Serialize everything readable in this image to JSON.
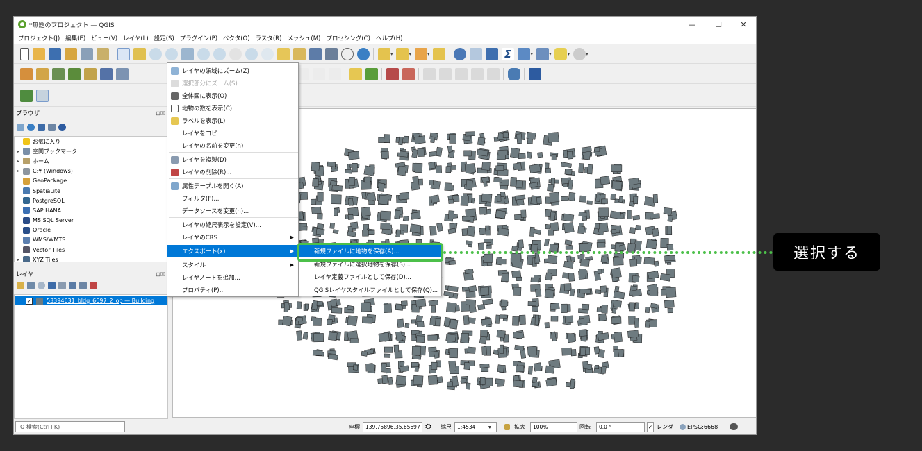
{
  "window": {
    "title": "*無題のプロジェクト — QGIS",
    "controls": [
      "—",
      "☐",
      "✕"
    ]
  },
  "menubar": [
    "プロジェクト(J)",
    "編集(E)",
    "ビュー(V)",
    "レイヤ(L)",
    "設定(S)",
    "プラグイン(P)",
    "ベクタ(O)",
    "ラスタ(R)",
    "メッシュ(M)",
    "プロセシング(C)",
    "ヘルプ(H)"
  ],
  "browser": {
    "title": "ブラウザ",
    "items": [
      {
        "label": "お気に入り",
        "icon": "star-icon",
        "arrow": ""
      },
      {
        "label": "空間ブックマーク",
        "icon": "bookmark-icon",
        "arrow": "▸"
      },
      {
        "label": "ホーム",
        "icon": "home-folder-icon",
        "arrow": "▸"
      },
      {
        "label": "C:¥ (Windows)",
        "icon": "drive-icon",
        "arrow": "▸"
      },
      {
        "label": "GeoPackage",
        "icon": "geopackage-icon",
        "arrow": ""
      },
      {
        "label": "SpatiaLite",
        "icon": "spatialite-icon",
        "arrow": ""
      },
      {
        "label": "PostgreSQL",
        "icon": "postgresql-icon",
        "arrow": ""
      },
      {
        "label": "SAP HANA",
        "icon": "sap-hana-icon",
        "arrow": ""
      },
      {
        "label": "MS SQL Server",
        "icon": "mssql-icon",
        "arrow": ""
      },
      {
        "label": "Oracle",
        "icon": "oracle-icon",
        "arrow": ""
      },
      {
        "label": "WMS/WMTS",
        "icon": "wms-icon",
        "arrow": ""
      },
      {
        "label": "Vector Tiles",
        "icon": "vector-tiles-icon",
        "arrow": ""
      },
      {
        "label": "XYZ Tiles",
        "icon": "xyz-tiles-icon",
        "arrow": "▸"
      }
    ]
  },
  "layers": {
    "title": "レイヤ",
    "layer_name": "53394631_bldg_6697_2_op — Building",
    "checked": "✓"
  },
  "context_menu": {
    "items": [
      {
        "label": "レイヤの領域にズーム(Z)",
        "icon": "zoom-layer-icon",
        "disabled": false,
        "submenu": false
      },
      {
        "label": "選択部分にズーム(S)",
        "icon": "zoom-selection-icon",
        "disabled": true,
        "submenu": false
      },
      {
        "label": "全体図に表示(O)",
        "icon": "overview-icon",
        "disabled": false,
        "submenu": false
      },
      {
        "label": "地物の数を表示(C)",
        "icon": "checkbox-icon",
        "disabled": false,
        "submenu": false
      },
      {
        "label": "ラベルを表示(L)",
        "icon": "label-icon",
        "disabled": false,
        "submenu": false
      },
      {
        "label": "レイヤをコピー",
        "icon": "",
        "disabled": false,
        "submenu": false
      },
      {
        "label": "レイヤの名前を変更(n)",
        "icon": "",
        "disabled": false,
        "submenu": false
      },
      {
        "label": "レイヤを複製(D)",
        "icon": "duplicate-icon",
        "disabled": false,
        "submenu": false
      },
      {
        "label": "レイヤの削除(R)...",
        "icon": "remove-layer-icon",
        "disabled": false,
        "submenu": false
      },
      {
        "label": "属性テーブルを開く(A)",
        "icon": "attribute-table-icon",
        "disabled": false,
        "submenu": false
      },
      {
        "label": "フィルタ(F)...",
        "icon": "",
        "disabled": false,
        "submenu": false
      },
      {
        "label": "データソースを変更(h)...",
        "icon": "",
        "disabled": false,
        "submenu": false
      },
      {
        "label": "レイヤの縮尺表示を設定(V)...",
        "icon": "",
        "disabled": false,
        "submenu": false
      },
      {
        "label": "レイヤのCRS",
        "icon": "",
        "disabled": false,
        "submenu": true
      },
      {
        "label": "エクスポート(x)",
        "icon": "",
        "disabled": false,
        "submenu": true,
        "highlighted": true
      },
      {
        "label": "スタイル",
        "icon": "",
        "disabled": false,
        "submenu": true
      },
      {
        "label": "レイヤノートを追加...",
        "icon": "",
        "disabled": false,
        "submenu": false
      },
      {
        "label": "プロパティ(P)...",
        "icon": "",
        "disabled": false,
        "submenu": false
      }
    ]
  },
  "export_submenu": {
    "items": [
      {
        "label": "新規ファイルに地物を保存(A)...",
        "highlighted": true
      },
      {
        "label": "新規ファイルに選択地物を保存(S)..."
      },
      {
        "label": "レイヤ定義ファイルとして保存(D)..."
      },
      {
        "label": "QGISレイヤスタイルファイルとして保存(Q)..."
      }
    ]
  },
  "callout": {
    "text": "選択する"
  },
  "statusbar": {
    "search_placeholder": "Q 検索(Ctrl+K)",
    "coord_label": "座標",
    "coord_value": "139.75896,35.65697",
    "scale_label": "縮尺",
    "scale_value": "1:4534",
    "magnifier_label": "拡大",
    "magnifier_value": "100%",
    "rotation_label": "回転",
    "rotation_value": "0.0 °",
    "render_label": "レンダ",
    "crs_label": "EPSG:6668"
  },
  "colors": {
    "highlight": "#0078d7",
    "callout_green": "#4cc04a",
    "building_fill": "#6e7b80"
  }
}
